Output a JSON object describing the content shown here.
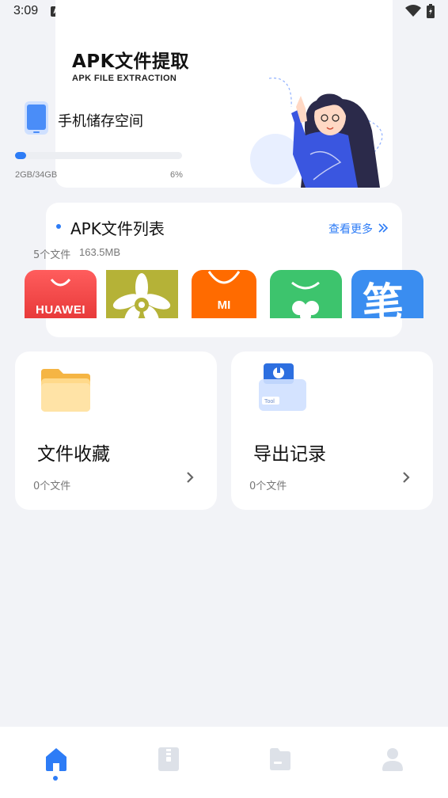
{
  "status_bar": {
    "time": "3:09",
    "notification_badge": "A"
  },
  "hero": {
    "title": "APK文件提取",
    "subtitle": "APK FILE EXTRACTION"
  },
  "storage": {
    "label": "手机储存空间",
    "used": "2GB/34GB",
    "percent_text": "6%",
    "fill_fraction": 0.06
  },
  "apk_list": {
    "title": "APK文件列表",
    "more_label": "查看更多",
    "count": "5个文件",
    "size": "163.5MB",
    "apps": [
      {
        "name": "huawei",
        "label": "HUAWEI"
      },
      {
        "name": "flower",
        "label": ""
      },
      {
        "name": "mi",
        "label": "MI"
      },
      {
        "name": "green",
        "label": ""
      },
      {
        "name": "bi",
        "label": "笔"
      }
    ]
  },
  "features": [
    {
      "title": "文件收藏",
      "count": "0个文件",
      "icon": "folder-icon"
    },
    {
      "title": "导出记录",
      "count": "0个文件",
      "icon": "tool-box-icon"
    }
  ],
  "bottom_nav": {
    "items": [
      "home-icon",
      "zip-icon",
      "file-icon",
      "user-icon"
    ],
    "active": "home-icon"
  },
  "colors": {
    "accent": "#2d7cf6",
    "background": "#f2f3f7"
  }
}
